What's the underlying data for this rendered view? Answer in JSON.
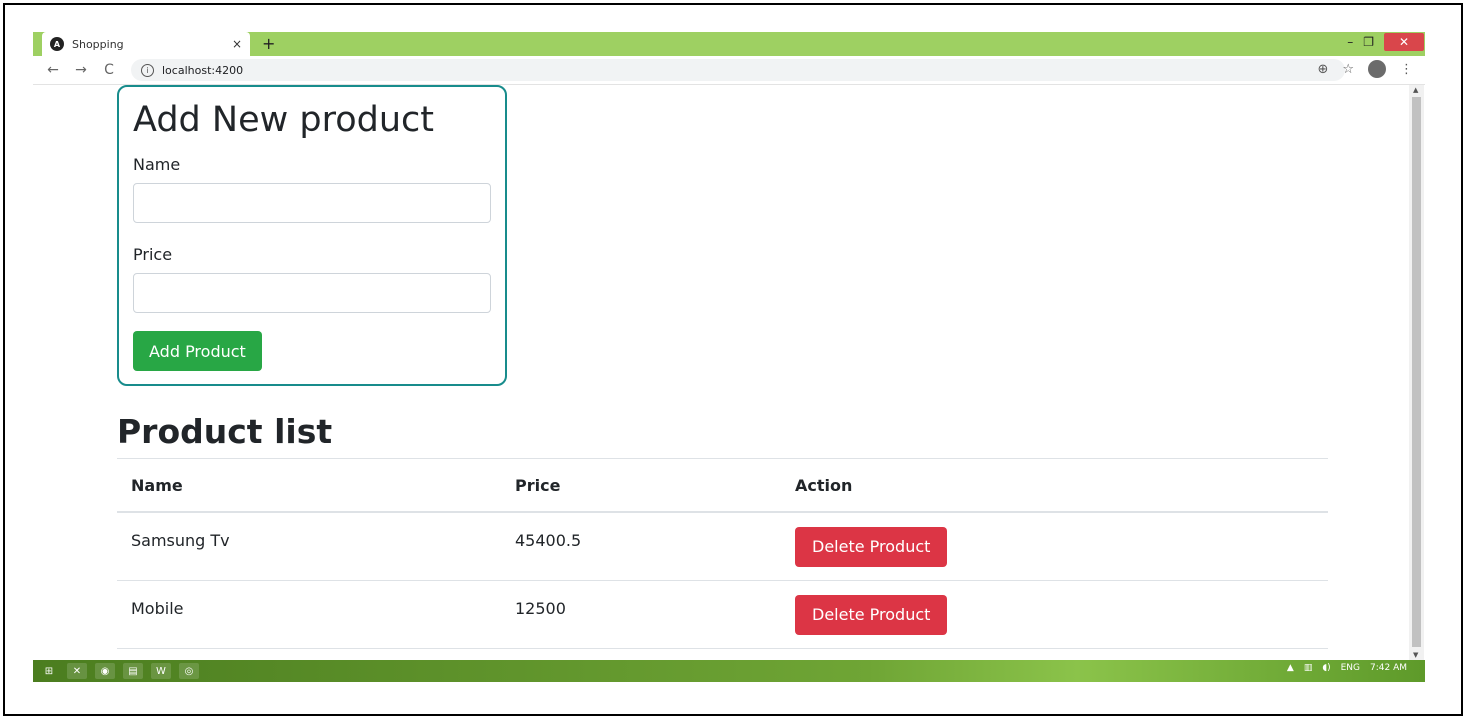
{
  "browser": {
    "tab_title": "Shopping",
    "tab_close": "×",
    "new_tab": "+",
    "url": "localhost:4200",
    "window_min": "–",
    "window_max": "❐",
    "window_close": "✕"
  },
  "form": {
    "title": "Add New product",
    "name_label": "Name",
    "name_value": "",
    "price_label": "Price",
    "price_value": "",
    "submit_label": "Add Product"
  },
  "product_list": {
    "title": "Product list",
    "columns": [
      "Name",
      "Price",
      "Action"
    ],
    "rows": [
      {
        "name": "Samsung Tv",
        "price": "45400.5",
        "action": "Delete Product"
      },
      {
        "name": "Mobile",
        "price": "12500",
        "action": "Delete Product"
      }
    ]
  },
  "taskbar": {
    "language": "ENG",
    "time": "7:42 AM"
  },
  "colors": {
    "chrome_green": "#9ed062",
    "card_border": "#188c8c",
    "add_button": "#28a745",
    "delete_button": "#dc3545"
  }
}
